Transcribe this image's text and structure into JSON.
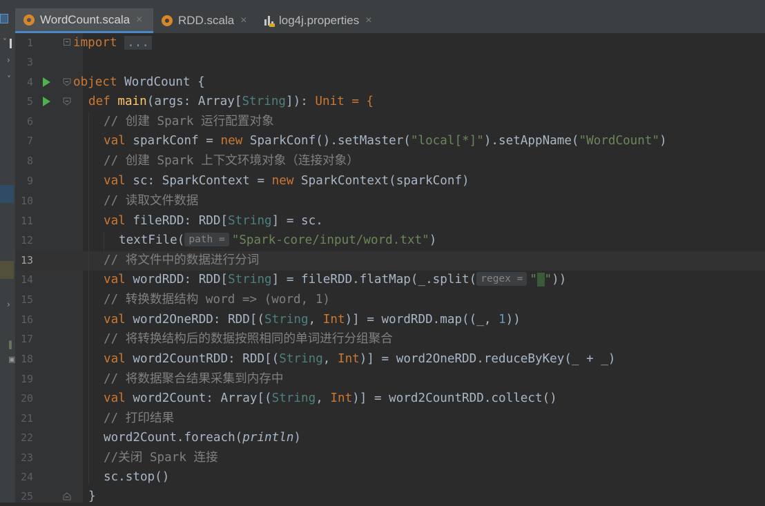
{
  "tabs": [
    {
      "label": "WordCount.scala",
      "icon": "scala-file-icon",
      "active": true
    },
    {
      "label": "RDD.scala",
      "icon": "scala-file-icon",
      "active": false
    },
    {
      "label": "log4j.properties",
      "icon": "properties-file-icon",
      "active": false
    }
  ],
  "tab_close_glyph": "×",
  "current_line": 13,
  "line_numbers": [
    "1",
    "3",
    "4",
    "5",
    "6",
    "7",
    "8",
    "9",
    "10",
    "11",
    "12",
    "13",
    "14",
    "15",
    "16",
    "17",
    "18",
    "19",
    "20",
    "21",
    "22",
    "23",
    "24",
    "25"
  ],
  "hints": {
    "path": "path =",
    "regex": "regex ="
  },
  "code": {
    "l1_kw": "import",
    "l1_ellipsis": "...",
    "l4_kw": "object",
    "l4_rest": " WordCount {",
    "l5_kw": "def",
    "l5_fn": "main",
    "l5_a": "(args: Array[",
    "l5_t": "String",
    "l5_b": "]): ",
    "l5_t2": "Unit",
    "l5_c": " = {",
    "l6": "// 创建 Spark 运行配置对象",
    "l7_kw": "val",
    "l7_a": " sparkConf = ",
    "l7_new": "new",
    "l7_b": " SparkConf().setMaster(",
    "l7_s1": "\"local[*]\"",
    "l7_c": ").setAppName(",
    "l7_s2": "\"WordCount\"",
    "l7_d": ")",
    "l8": "// 创建 Spark 上下文环境对象（连接对象）",
    "l9_kw": "val",
    "l9_a": " sc: SparkContext = ",
    "l9_new": "new",
    "l9_b": " SparkContext(sparkConf)",
    "l10": "// 读取文件数据",
    "l11_kw": "val",
    "l11_a": " fileRDD: RDD[",
    "l11_t": "String",
    "l11_b": "] = sc.",
    "l12_a": "textFile(",
    "l12_s": "\"Spark-core/input/word.txt\"",
    "l12_b": ")",
    "l13": "// 将文件中的数据进行分词",
    "l14_kw": "val",
    "l14_a": " wordRDD: RDD[",
    "l14_t": "String",
    "l14_b": "] = fileRDD.flatMap(_.split(",
    "l14_s1": "\"",
    "l14_s2": "\"",
    "l14_c": "))",
    "l15": "// 转换数据结构 word => (word, 1)",
    "l16_kw": "val",
    "l16_a": " word2OneRDD: RDD[(",
    "l16_t": "String",
    "l16_b": ", ",
    "l16_t2": "Int",
    "l16_c": ")] = wordRDD.map((_, ",
    "l16_n": "1",
    "l16_d": "))",
    "l17": "// 将转换结构后的数据按照相同的单词进行分组聚合",
    "l18_kw": "val",
    "l18_a": " word2CountRDD: RDD[(",
    "l18_t": "String",
    "l18_b": ", ",
    "l18_t2": "Int",
    "l18_c": ")] = word2OneRDD.reduceByKey(_ + _)",
    "l19": "// 将数据聚合结果采集到内存中",
    "l20_kw": "val",
    "l20_a": " word2Count: Array[(",
    "l20_t": "String",
    "l20_b": ", ",
    "l20_t2": "Int",
    "l20_c": ")] = word2CountRDD.collect()",
    "l21": "// 打印结果",
    "l22_a": "word2Count.foreach(",
    "l22_it": "println",
    "l22_b": ")",
    "l23": "//关闭 Spark 连接",
    "l24": "sc.stop()",
    "l25": "}"
  },
  "colors": {
    "keyword": "#cc7832",
    "function": "#ffc66d",
    "string": "#6a8759",
    "number": "#6897bb",
    "comment": "#808080",
    "type": "#4e807d",
    "text": "#a9b7c6",
    "run_gutter": "#4fb04f"
  }
}
